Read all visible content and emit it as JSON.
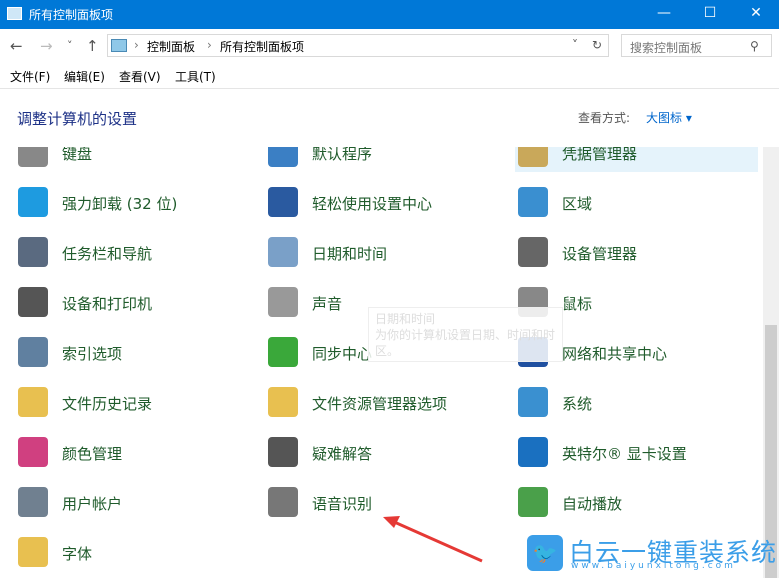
{
  "window": {
    "title": "所有控制面板项",
    "minimize": "—",
    "maximize": "☐",
    "close": "✕"
  },
  "nav": {
    "back": "←",
    "forward": "→",
    "recent": "˅",
    "up": "↑"
  },
  "address": {
    "crumbs": [
      "控制面板",
      "所有控制面板项"
    ],
    "sep": "›",
    "dropdown": "˅",
    "refresh": "↻"
  },
  "search": {
    "placeholder": "搜索控制面板",
    "icon": "⚲"
  },
  "menu": [
    "文件(F)",
    "编辑(E)",
    "查看(V)",
    "工具(T)"
  ],
  "header": {
    "title": "调整计算机的设置",
    "view_label": "查看方式:",
    "view_value": "大图标 ▾"
  },
  "items": [
    [
      "键盘",
      "默认程序",
      "凭据管理器"
    ],
    [
      "强力卸载 (32 位)",
      "轻松使用设置中心",
      "区域"
    ],
    [
      "任务栏和导航",
      "日期和时间",
      "设备管理器"
    ],
    [
      "设备和打印机",
      "声音",
      "鼠标"
    ],
    [
      "索引选项",
      "同步中心",
      "网络和共享中心"
    ],
    [
      "文件历史记录",
      "文件资源管理器选项",
      "系统"
    ],
    [
      "颜色管理",
      "疑难解答",
      "英特尔® 显卡设置"
    ],
    [
      "用户帐户",
      "语音识别",
      "自动播放"
    ],
    [
      "字体"
    ]
  ],
  "icon_colors": [
    [
      "#888888",
      "#3b7fc4",
      "#c9a85a"
    ],
    [
      "#1e9be0",
      "#2a5aa0",
      "#3a8fd0"
    ],
    [
      "#5a6a80",
      "#7aa0c8",
      "#666666"
    ],
    [
      "#555555",
      "#999999",
      "#888888"
    ],
    [
      "#6080a0",
      "#3aa83a",
      "#2050a0"
    ],
    [
      "#e8c050",
      "#e8c050",
      "#3a90d0"
    ],
    [
      "#d04080",
      "#555555",
      "#1a70c0"
    ],
    [
      "#708090",
      "#777777",
      "#4aa04a"
    ],
    [
      "#e8c050"
    ]
  ],
  "tooltip": {
    "title": "日期和时间",
    "desc": "为你的计算机设置日期、时间和时区。"
  },
  "watermark": {
    "brand": "白云一键重装系统",
    "url": "www.baiyunxitong.com"
  },
  "accent": "#0078d7"
}
